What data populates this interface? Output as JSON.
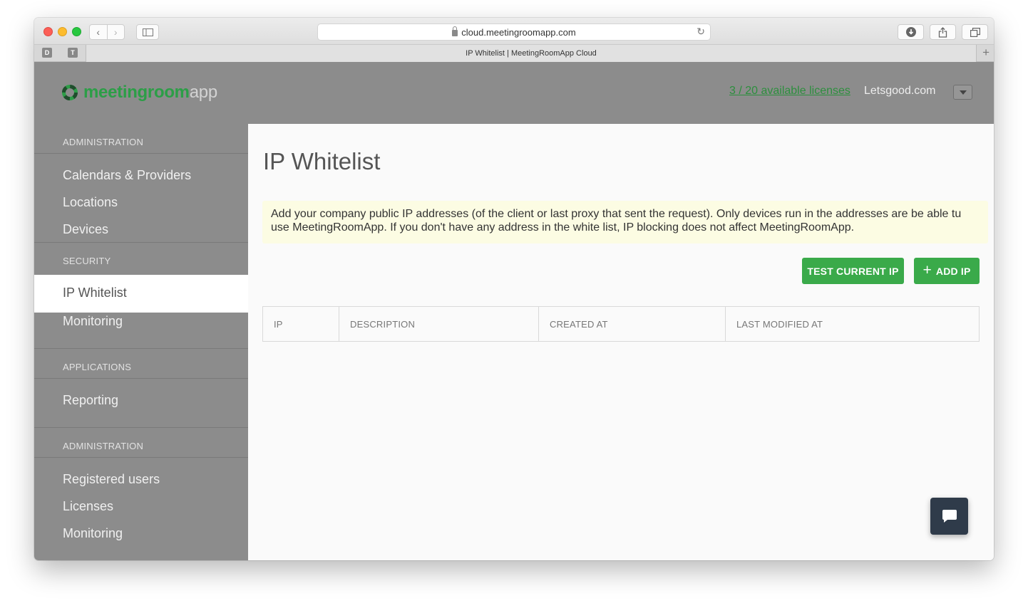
{
  "browser": {
    "url": "cloud.meetingroomapp.com",
    "tab_title": "IP Whitelist | MeetingRoomApp Cloud",
    "favicons": [
      "D",
      "T"
    ],
    "back_glyph": "‹",
    "forward_glyph": "›",
    "reload_glyph": "↻",
    "new_tab_glyph": "+"
  },
  "header": {
    "logo_main": "meetingroom",
    "logo_suffix": "app",
    "licenses": "3 / 20 available licenses",
    "company": "Letsgood.com"
  },
  "sidebar": {
    "sections": [
      {
        "title": "ADMINISTRATION",
        "items": [
          "Calendars & Providers",
          "Locations",
          "Devices"
        ]
      },
      {
        "title": "SECURITY",
        "items": [
          "IP Whitelist",
          "Monitoring"
        ]
      },
      {
        "title": "APPLICATIONS",
        "items": [
          "Reporting"
        ]
      },
      {
        "title": "ADMINISTRATION",
        "items": [
          "Registered users",
          "Licenses",
          "Monitoring"
        ]
      }
    ],
    "active_item": "IP Whitelist"
  },
  "main": {
    "title": "IP Whitelist",
    "notice": "Add your company public IP addresses (of the client or last proxy that sent the request). Only devices run in the addresses are be able tu use MeetingRoomApp. If you don't have any address in the white list, IP blocking does not affect MeetingRoomApp.",
    "test_button": "TEST CURRENT IP",
    "add_button": "ADD IP",
    "add_glyph": "+",
    "table_headers": [
      "IP",
      "DESCRIPTION",
      "CREATED AT",
      "LAST MODIFIED AT"
    ]
  },
  "colors": {
    "accent_green": "#3aaa4a",
    "sidebar_gray": "#8c8c8c",
    "notice_bg": "#fcfce3",
    "chat_bg": "#2f3b4a"
  }
}
